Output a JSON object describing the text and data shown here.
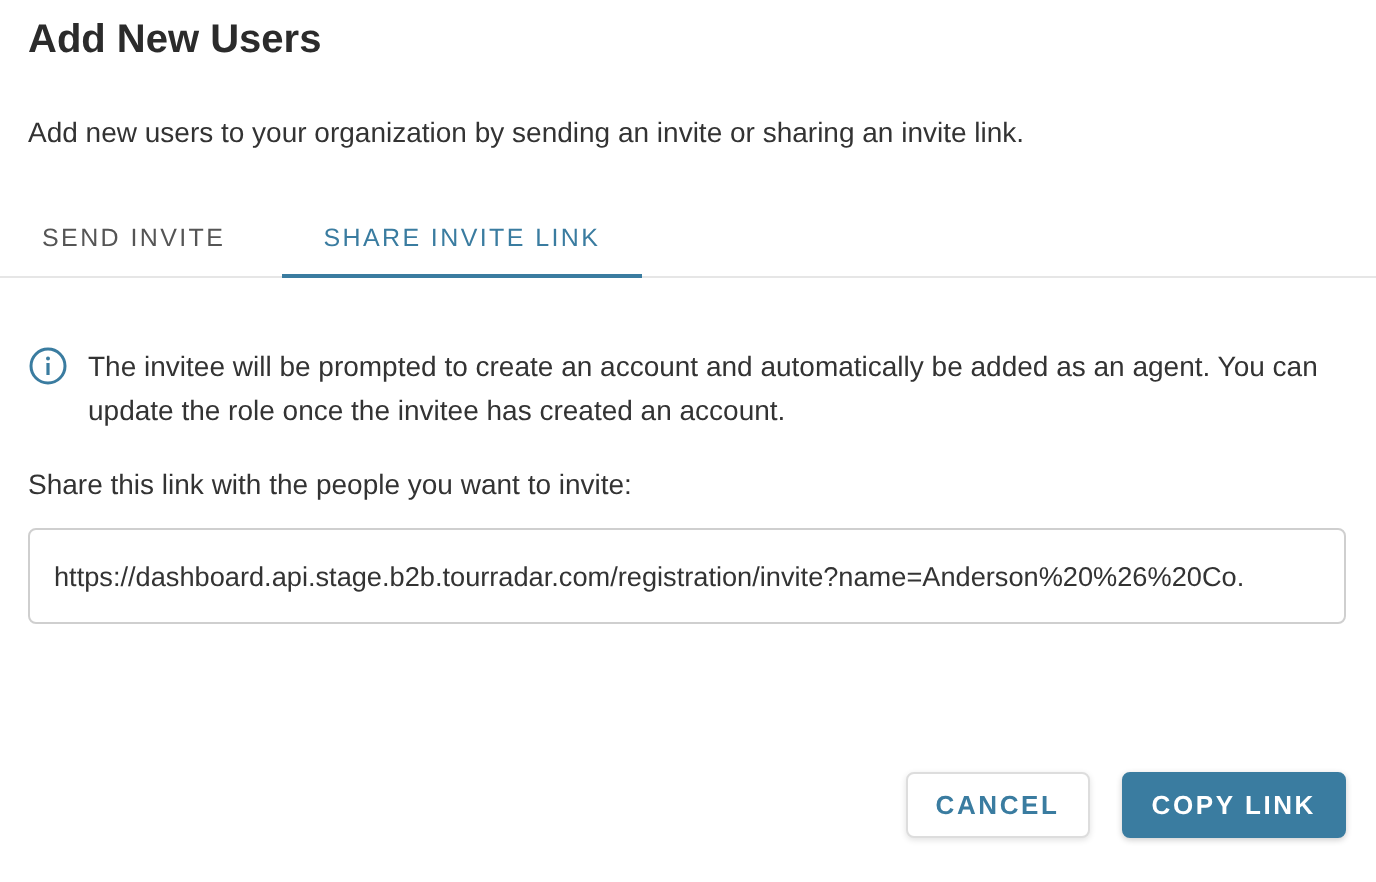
{
  "dialog": {
    "title": "Add New Users",
    "description": "Add new users to your organization by sending an invite or sharing an invite link."
  },
  "tabs": [
    {
      "label": "SEND INVITE",
      "selected": false
    },
    {
      "label": "SHARE INVITE LINK",
      "selected": true
    }
  ],
  "info": {
    "text": "The invitee will be prompted to create an account and automatically be added as an agent. You can update the role once the invitee has created an account."
  },
  "link_field": {
    "label": "Share this link with the people you want to invite:",
    "value": "https://dashboard.api.stage.b2b.tourradar.com/registration/invite?name=Anderson%20%26%20Co."
  },
  "buttons": [
    {
      "label": "CANCEL",
      "kind": "secondary"
    },
    {
      "label": "COPY LINK",
      "kind": "primary"
    }
  ]
}
